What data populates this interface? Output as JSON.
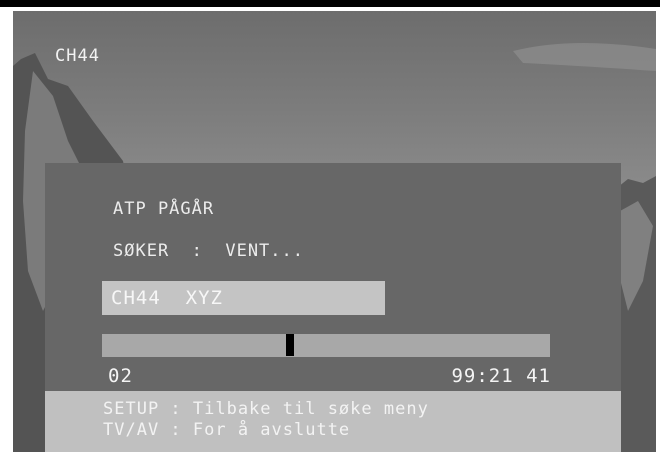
{
  "channel_osd": "CH44",
  "panel": {
    "status_title": "ATP PÅGÅR",
    "search_status": "SØKER  :  VENT...",
    "channel_name": "CH44  XYZ",
    "progress": {
      "fraction": 0.42,
      "range_start": "02",
      "range_end": "99:21 41"
    },
    "help": [
      "SETUP : Tilbake til søke meny",
      "TV/AV : For å avslutte"
    ]
  }
}
